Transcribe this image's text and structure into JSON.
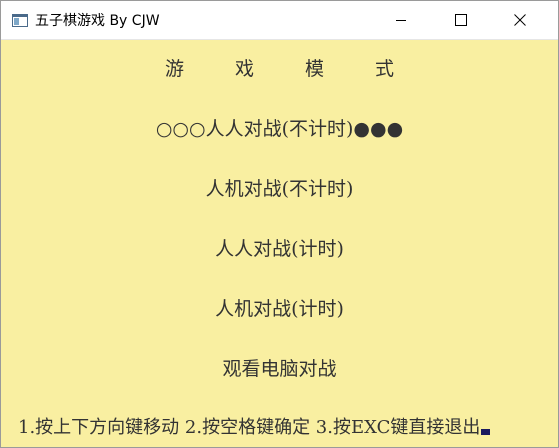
{
  "window": {
    "title": "五子棋游戏 By CJW",
    "icon": "app-window-icon",
    "controls": [
      "minimize-icon",
      "maximize-icon",
      "close-icon"
    ]
  },
  "menu": {
    "heading_chars": [
      "游",
      "戏",
      "模",
      "式"
    ],
    "selected_prefix": "○○○",
    "selected_suffix": "●●●",
    "items": [
      "人人对战(不计时)",
      "人机对战(不计时)",
      "人人对战(计时)",
      "人机对战(计时)",
      "观看电脑对战"
    ],
    "selected_index": 0
  },
  "footer": {
    "instructions": "1.按上下方向键移动 2.按空格键确定 3.按EXC键直接退出"
  },
  "colors": {
    "background": "#f9efa1",
    "text": "#333333",
    "titlebar": "#ffffff"
  }
}
